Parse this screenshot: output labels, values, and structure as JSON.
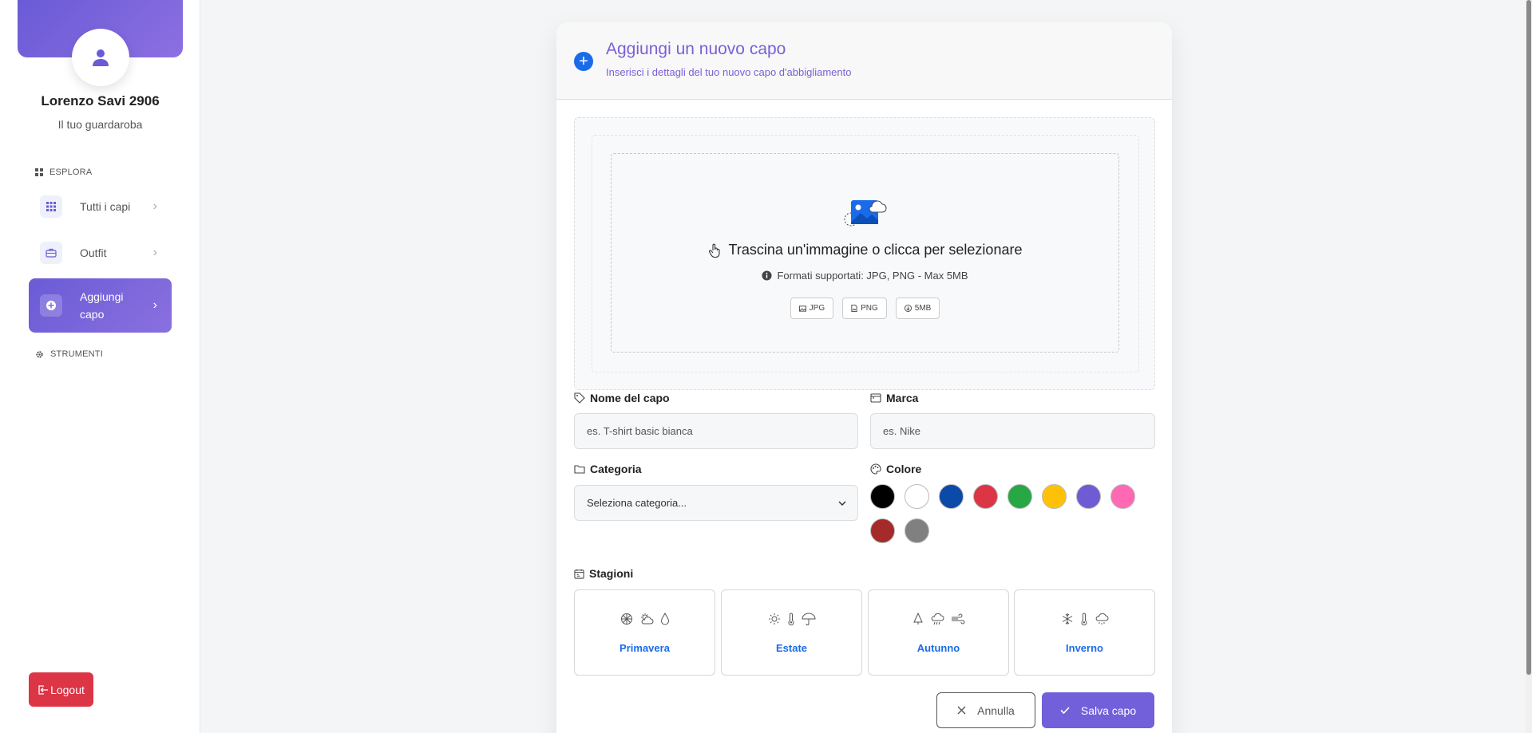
{
  "user": {
    "name": "Lorenzo Savi 2906",
    "subtitle": "Il tuo guardaroba"
  },
  "sidebar": {
    "section_explore": "ESPLORA",
    "section_tools": "STRUMENTI",
    "items": [
      {
        "label": "Tutti i capi",
        "icon": "grid-icon"
      },
      {
        "label": "Outfit",
        "icon": "wardrobe-icon"
      },
      {
        "label": "Aggiungi capo",
        "icon": "plus-circle-icon",
        "active": true
      }
    ],
    "logout": "Logout"
  },
  "modal": {
    "title": "Aggiungi un nuovo capo",
    "subtitle": "Inserisci i dettagli del tuo nuovo capo d'abbigliamento",
    "upload": {
      "title": "Trascina un'immagine o clicca per selezionare",
      "formats": "Formati supportati: JPG, PNG - Max 5MB",
      "chips": [
        "JPG",
        "PNG",
        "5MB"
      ]
    },
    "fields": {
      "name_label": "Nome del capo",
      "name_placeholder": "es. T-shirt basic bianca",
      "brand_label": "Marca",
      "brand_placeholder": "es. Nike",
      "category_label": "Categoria",
      "category_value": "Seleziona categoria...",
      "color_label": "Colore",
      "colors": [
        "#000000",
        "#ffffff",
        "#0b4aa8",
        "#dc3545",
        "#28a745",
        "#ffc107",
        "#6f5bd4",
        "#ff69b4",
        "#a52a2a",
        "#808080"
      ]
    },
    "seasons_label": "Stagioni",
    "seasons": [
      {
        "label": "Primavera",
        "icons": [
          "flower-icon",
          "sun-cloud-icon",
          "droplet-icon"
        ]
      },
      {
        "label": "Estate",
        "icons": [
          "sun-icon",
          "thermometer-icon",
          "umbrella-icon"
        ]
      },
      {
        "label": "Autunno",
        "icons": [
          "leaf-icon",
          "cloud-rain-icon",
          "wind-icon"
        ]
      },
      {
        "label": "Inverno",
        "icons": [
          "snowflake-icon",
          "thermometer-icon",
          "cloud-snow-icon"
        ]
      }
    ],
    "cancel_label": "Annulla",
    "save_label": "Salva capo"
  }
}
